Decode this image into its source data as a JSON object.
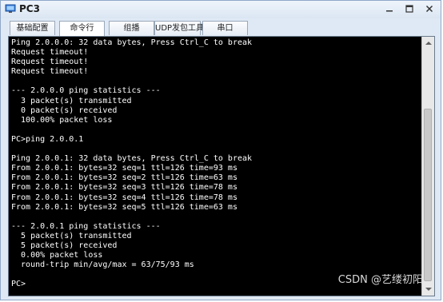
{
  "window": {
    "title": "PC3",
    "icon": "pc-monitor-icon"
  },
  "tabs": [
    {
      "label": "基础配置",
      "active": false
    },
    {
      "label": "命令行",
      "active": true
    },
    {
      "label": "组播",
      "active": false
    },
    {
      "label": "UDP发包工具",
      "active": false
    },
    {
      "label": "串口",
      "active": false
    }
  ],
  "terminal": {
    "lines": [
      "Ping 2.0.0.0: 32 data bytes, Press Ctrl_C to break",
      "Request timeout!",
      "Request timeout!",
      "Request timeout!",
      "",
      "--- 2.0.0.0 ping statistics ---",
      "  3 packet(s) transmitted",
      "  0 packet(s) received",
      "  100.00% packet loss",
      "",
      "PC>ping 2.0.0.1",
      "",
      "Ping 2.0.0.1: 32 data bytes, Press Ctrl_C to break",
      "From 2.0.0.1: bytes=32 seq=1 ttl=126 time=93 ms",
      "From 2.0.0.1: bytes=32 seq=2 ttl=126 time=63 ms",
      "From 2.0.0.1: bytes=32 seq=3 ttl=126 time=78 ms",
      "From 2.0.0.1: bytes=32 seq=4 ttl=126 time=78 ms",
      "From 2.0.0.1: bytes=32 seq=5 ttl=126 time=63 ms",
      "",
      "--- 2.0.0.1 ping statistics ---",
      "  5 packet(s) transmitted",
      "  5 packet(s) received",
      "  0.00% packet loss",
      "  round-trip min/avg/max = 63/75/93 ms",
      "",
      "PC>"
    ]
  },
  "watermark": "CSDN @艺缕初阳",
  "colors": {
    "terminal_bg": "#000000",
    "terminal_fg": "#ffffff",
    "window_bg": "#dfe9f5"
  }
}
